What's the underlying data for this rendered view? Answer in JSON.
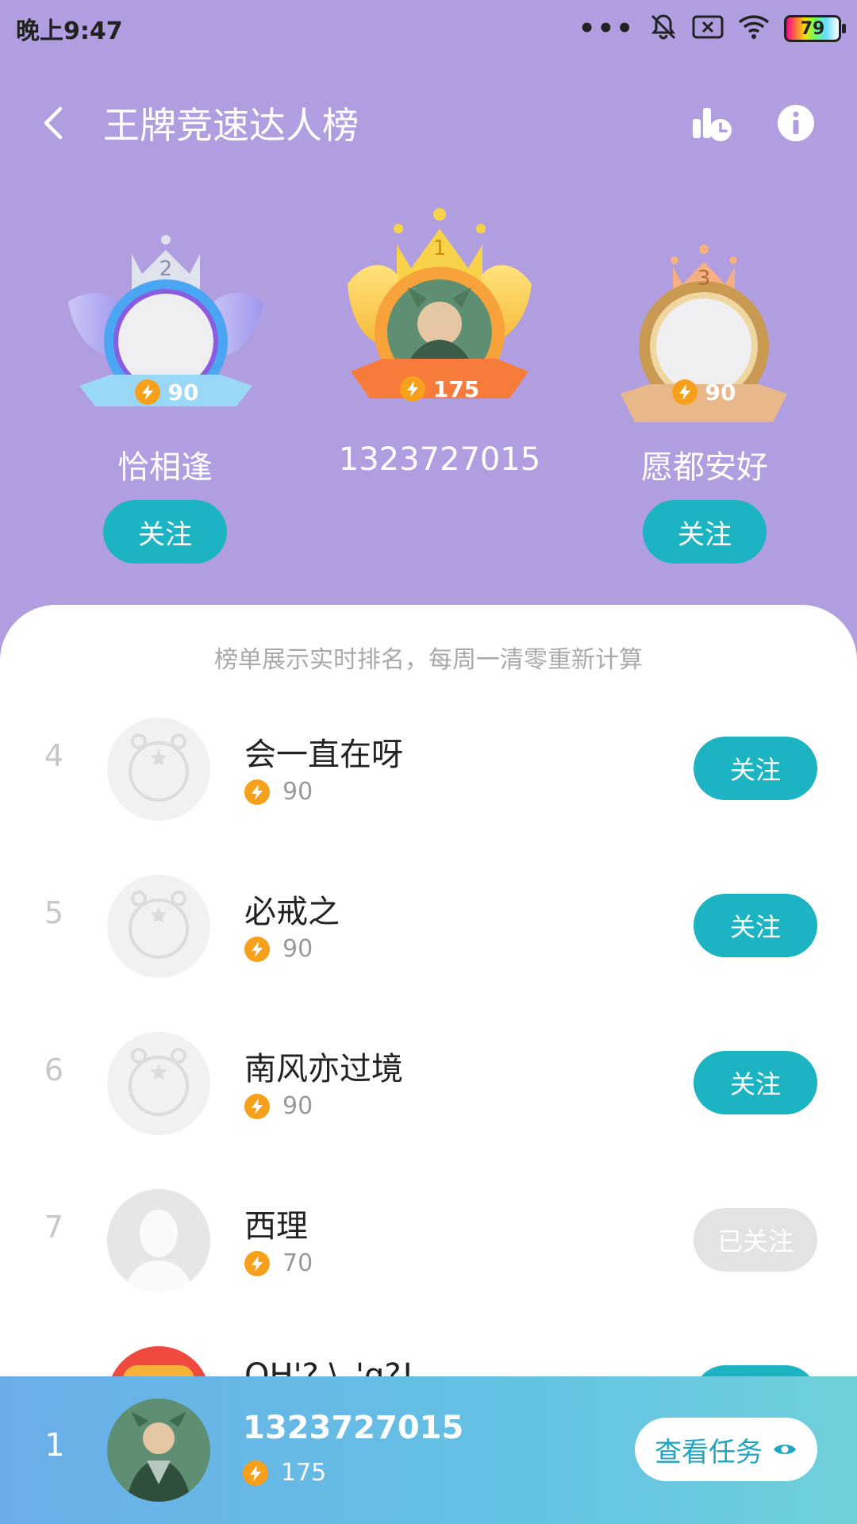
{
  "status_bar": {
    "time": "晚上9:47",
    "dots": "•••",
    "battery": "79"
  },
  "header": {
    "title": "王牌竞速达人榜"
  },
  "podium": {
    "second": {
      "rank": "2",
      "name": "恰相逢",
      "score": "90",
      "follow": "关注"
    },
    "first": {
      "rank": "1",
      "name": "1323727015",
      "score": "175"
    },
    "third": {
      "rank": "3",
      "name": "愿都安好",
      "score": "90",
      "follow": "关注"
    }
  },
  "notice": "榜单展示实时排名，每周一清零重新计算",
  "rows": [
    {
      "rank": "4",
      "name": "会一直在呀",
      "score": "90",
      "button": "关注"
    },
    {
      "rank": "5",
      "name": "必戒之",
      "score": "90",
      "button": "关注"
    },
    {
      "rank": "6",
      "name": "南风亦过境",
      "score": "90",
      "button": "关注"
    },
    {
      "rank": "7",
      "name": "西理",
      "score": "70",
      "button": "已关注"
    },
    {
      "rank": "",
      "name": "OH'? \\_'q?!",
      "score": "",
      "button": ""
    }
  ],
  "my_bar": {
    "rank": "1",
    "name": "1323727015",
    "score": "175",
    "task_button": "查看任务"
  },
  "colors": {
    "header_bg": "#b19ee0",
    "accent": "#1cb3c2",
    "bolt": "#f7a01c"
  }
}
